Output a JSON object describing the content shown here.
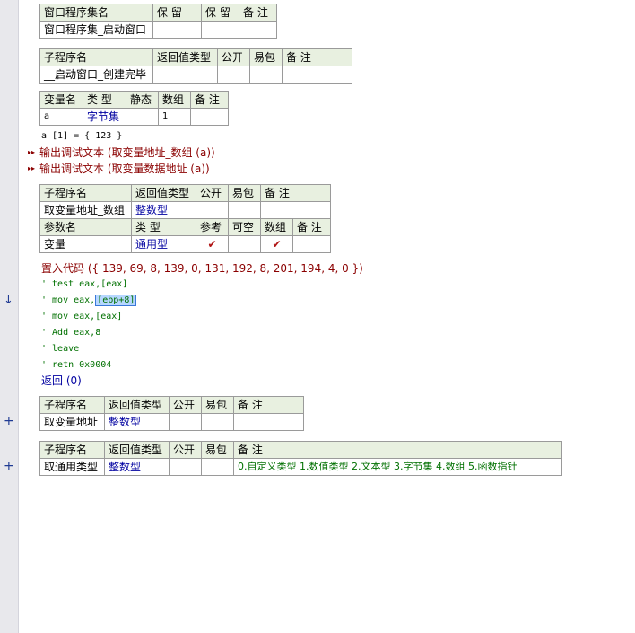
{
  "window_set": {
    "headers": [
      "窗口程序集名",
      "保 留",
      "保 留",
      "备 注"
    ],
    "row": [
      "窗口程序集_启动窗口",
      "",
      "",
      ""
    ]
  },
  "sub1": {
    "headers": [
      "子程序名",
      "返回值类型",
      "公开",
      "易包",
      "备 注"
    ],
    "row": [
      "__启动窗口_创建完毕",
      "",
      "",
      "",
      ""
    ],
    "var_headers": [
      "变量名",
      "类 型",
      "静态",
      "数组",
      "备 注"
    ],
    "var_row": [
      "a",
      "字节集",
      "",
      "1",
      ""
    ]
  },
  "code1": {
    "assign": "a [1] = { 123 }",
    "call1": "输出调试文本 (取变量地址_数组 (a))",
    "call2": "输出调试文本 (取变量数据地址 (a))"
  },
  "sub2": {
    "headers": [
      "子程序名",
      "返回值类型",
      "公开",
      "易包",
      "备 注"
    ],
    "row": [
      "取变量地址_数组",
      "整数型",
      "",
      "",
      ""
    ],
    "param_headers": [
      "参数名",
      "类 型",
      "参考",
      "可空",
      "数组",
      "备 注"
    ],
    "param_row": [
      "变量",
      "通用型",
      "✔",
      "",
      "✔",
      ""
    ]
  },
  "code2": {
    "insert": "置入代码 ({ 139, 69, 8, 139, 0, 131, 192, 8, 201, 194, 4, 0 })",
    "c1": "' test eax,[eax]",
    "c2_pre": "' mov eax,",
    "c2_sel": "[ebp+8]",
    "c3": "' mov eax,[eax]",
    "c4": "' Add eax,8",
    "c5": "' leave",
    "c6": "' retn 0x0004",
    "ret": "返回 (0)"
  },
  "sub3": {
    "headers": [
      "子程序名",
      "返回值类型",
      "公开",
      "易包",
      "备 注"
    ],
    "row": [
      "取变量地址",
      "整数型",
      "",
      "",
      ""
    ]
  },
  "sub4": {
    "headers": [
      "子程序名",
      "返回值类型",
      "公开",
      "易包",
      "备 注"
    ],
    "row": [
      "取通用类型",
      "整数型",
      "",
      "",
      "0.自定义类型 1.数值类型 2.文本型 3.字节集 4.数组 5.函数指针"
    ]
  },
  "gutter": {
    "breakpoint_arrow": "↓",
    "expand1": "+",
    "expand2": "+",
    "call_arrow": "▸▸"
  },
  "colors": {
    "header_bg": "#e8f0e0",
    "keyword": "#8b0000",
    "type_blue": "#0000a0",
    "comment_green": "#007000"
  }
}
